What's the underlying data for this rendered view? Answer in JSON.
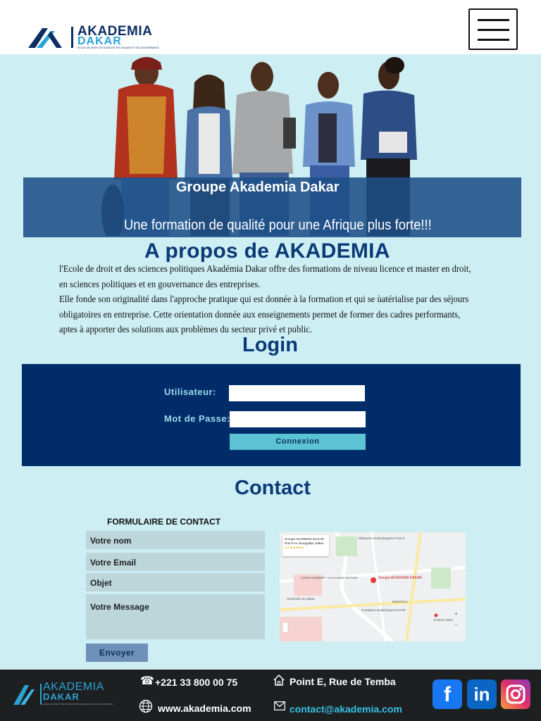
{
  "header": {
    "brand_line1": "AKADEMIA",
    "brand_line2": "DAKAR",
    "brand_tagline": "ECOLE DE DROIT DE SCIENCES POLITIQUES ET DE GOUVERNANCE",
    "menu_icon": "hamburger-menu-icon"
  },
  "hero": {
    "title": "Groupe Akademia Dakar",
    "subtitle": "Une formation de qualité pour une Afrique plus forte!!!"
  },
  "about": {
    "title": "A propos de AKADEMIA",
    "lines": [
      "l'Ecole de droit et des sciences politiques Akadémia Dakar offre des formations de niveau licence et master en droit,",
      " en sciences politiques et en gouvernance des entreprises.",
      "Elle fonde son originalité dans l'approche pratique qui est donnée à la formation et qui se ùatérialise par des séjours",
      "obligatoires en entreprise. Cette orientation donnée aux enseignements permet de former des cadres performants,",
      "aptes à apporter des solutions aux problèmes du secteur privé et public."
    ]
  },
  "login": {
    "title": "Login",
    "user_label": "Utilisateur:",
    "password_label": "Mot de Passe:",
    "user_value": "",
    "password_value": "",
    "submit_label": "Connexion"
  },
  "contact": {
    "title": "Contact",
    "form_heading": "FORMULAIRE DE CONTACT",
    "name_placeholder": "Votre nom",
    "email_placeholder": "Votre Email",
    "subject_placeholder": "Objet",
    "message_placeholder": "Votre Message",
    "send_label": "Envoyer",
    "map": {
      "card_title": "Groupe AKADEMIA DAKAR",
      "card_address": "Rue 8 Av. Bourguiba, Dakar",
      "card_rating": "4,5 ★★★★★",
      "pin_label": "Groupe AKADEMIA DAKAR",
      "places": [
        "Pâtisserie et Boulangerie Point E",
        "Centre Hospitalier Universitaire De Fann",
        "Université de Dakar",
        "Complexe académique DAKAR",
        "Waterfront",
        "Cinéma Akkol"
      ]
    }
  },
  "footer": {
    "brand_line1": "AKADEMIA",
    "brand_line2": "DAKAR",
    "brand_tagline": "ECOLE DE DROIT DE SCIENCES POLITIQUES ET DE GOUVERNANCE",
    "phone": "+221 33 800 00 75",
    "address": "Point E, Rue de Temba",
    "website": "www.akademia.com",
    "email": "contact@akademia.com",
    "social": {
      "facebook": "f",
      "linkedin": "in"
    }
  },
  "colors": {
    "page_bg": "#cdeef2",
    "navy": "#002d6a",
    "title_blue": "#0b3a78",
    "accent_cyan": "#5bc3d3",
    "footer_bg": "#1d1f21"
  }
}
